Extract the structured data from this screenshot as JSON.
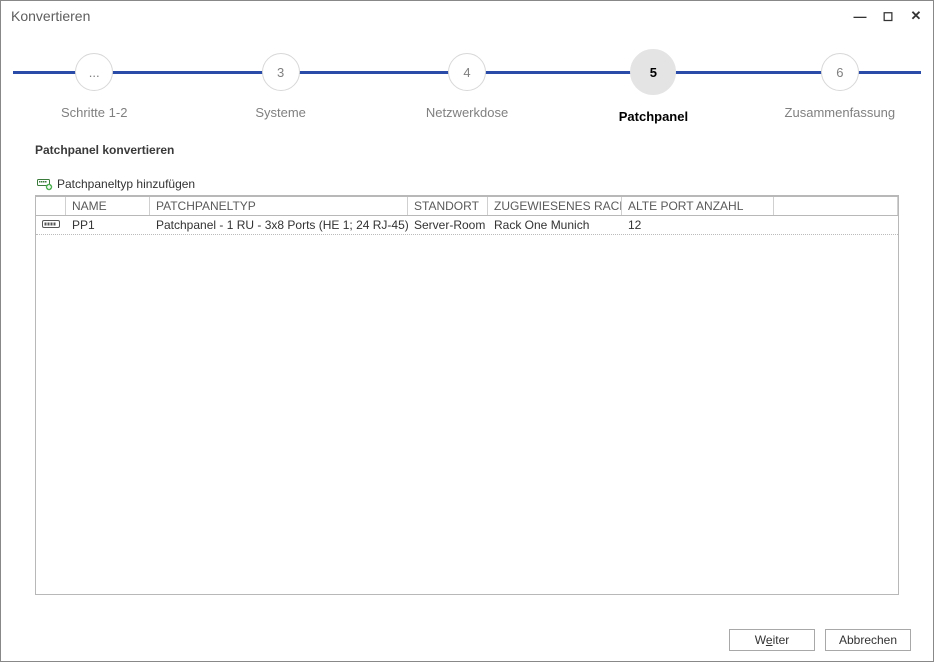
{
  "window": {
    "title": "Konvertieren"
  },
  "steps": [
    {
      "num": "...",
      "label": "Schritte 1-2"
    },
    {
      "num": "3",
      "label": "Systeme"
    },
    {
      "num": "4",
      "label": "Netzwerkdose"
    },
    {
      "num": "5",
      "label": "Patchpanel"
    },
    {
      "num": "6",
      "label": "Zusammenfassung"
    }
  ],
  "active_step_index": 3,
  "section": {
    "title": "Patchpanel konvertieren"
  },
  "toolbar": {
    "add_label": "Patchpaneltyp hinzufügen"
  },
  "columns": {
    "name": "NAME",
    "type": "PATCHPANELTYP",
    "location": "STANDORT",
    "rack": "ZUGEWIESENES RACK",
    "ports": "ALTE PORT ANZAHL"
  },
  "rows": [
    {
      "name": "PP1",
      "type": "Patchpanel - 1 RU - 3x8 Ports (HE 1; 24 RJ-45)",
      "location": "Server-Room",
      "rack": "Rack One Munich",
      "ports": "12"
    }
  ],
  "buttons": {
    "next_pre": "W",
    "next_u": "e",
    "next_post": "iter",
    "cancel": "Abbrechen"
  }
}
